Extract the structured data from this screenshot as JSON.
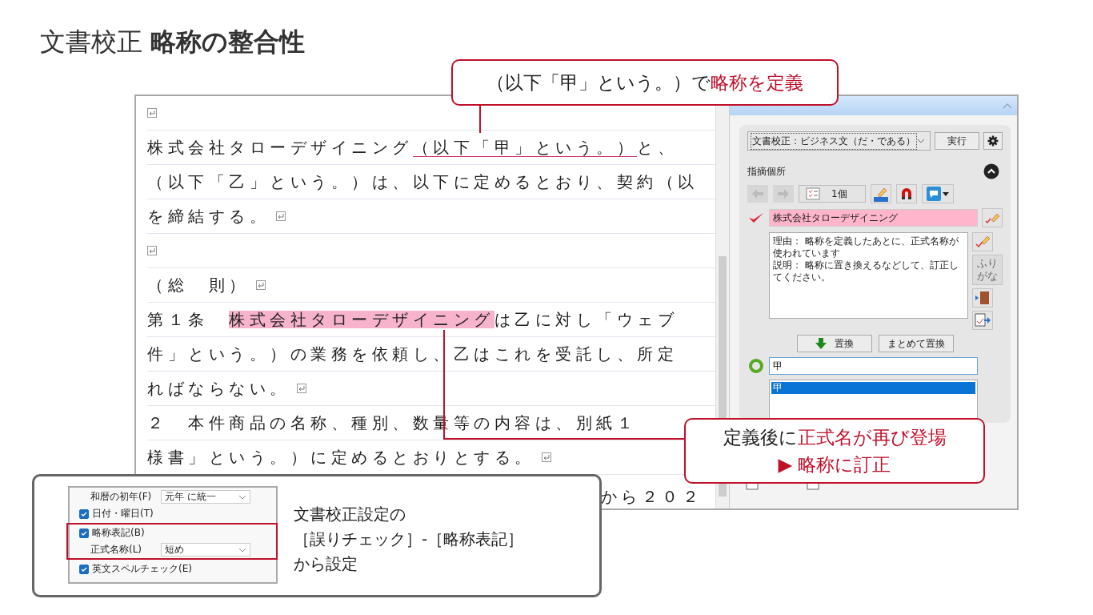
{
  "title": "文書校正 **略称の整合性**",
  "document": {
    "lines": [
      {
        "return_mark": true
      },
      {
        "segments": [
          {
            "text": "株式会社タローデザイニング",
            "kind": "plain"
          },
          {
            "text": "（以下「甲」という。）",
            "kind": "underlined"
          },
          {
            "text": "と、",
            "kind": "plain"
          }
        ],
        "return_mark": false
      },
      {
        "segments": [
          {
            "text": "（以下「乙」という。）は、以下に定めるとおり、契約（以",
            "kind": "plain"
          }
        ],
        "return_mark": false
      },
      {
        "segments": [
          {
            "text": "を締結する。",
            "kind": "plain"
          }
        ],
        "return_mark": true
      },
      {
        "return_mark": true
      },
      {
        "segments": [
          {
            "text": "（総　則）",
            "kind": "plain"
          }
        ],
        "return_mark": true
      },
      {
        "segments": [
          {
            "text": "第１条　",
            "kind": "plain"
          },
          {
            "text": "株式会社タローデザイニング",
            "kind": "highlighted"
          },
          {
            "text": "は乙に対し「ウェブ",
            "kind": "plain"
          }
        ],
        "return_mark": false
      },
      {
        "segments": [
          {
            "text": "件」という。）の業務を依頼し、乙はこれを受託し、所定",
            "kind": "plain"
          }
        ],
        "return_mark": false
      },
      {
        "segments": [
          {
            "text": "ればならない。",
            "kind": "plain"
          }
        ],
        "return_mark": true
      },
      {
        "segments": [
          {
            "text": "２　本件商品の名称、種別、数量等の内容は、別紙１",
            "kind": "plain"
          }
        ],
        "return_mark": false
      },
      {
        "segments": [
          {
            "text": "様書」という。）に定めるとおりとする。",
            "kind": "plain"
          }
        ],
        "return_mark": true
      }
    ],
    "partial_line": "から２０２"
  },
  "panel": {
    "profile_select": {
      "value": "文書校正：ビジネス文（だ・である）"
    },
    "run_button": "実行",
    "section_label": "指摘個所",
    "nav": [
      {
        "kind": "back",
        "disabled": true
      },
      {
        "kind": "forward",
        "disabled": true
      }
    ],
    "count": "1個",
    "flagged_text": "株式会社タローデザイニング",
    "message": [
      "理由： 略称を定義したあとに、正式名称が使われています",
      "説明： 略称に置き換えるなどして、訂正してください。"
    ],
    "furigana_button": {
      "label": "ふりがな",
      "disabled": true
    },
    "replace_button": "置換",
    "replace_all_button": "まとめて置換",
    "candidate_input": {
      "value": "甲"
    },
    "candidates": [
      {
        "label": "甲",
        "selected": true
      }
    ]
  },
  "callouts": [
    {
      "kind": "top",
      "lines": [
        [
          {
            "text": "（以下「甲」という。）で",
            "emphasis": false
          },
          {
            "text": "略称を定義",
            "emphasis": true
          }
        ]
      ]
    },
    {
      "kind": "bottom",
      "lines": [
        [
          {
            "text": "定義後に",
            "emphasis": false
          },
          {
            "text": "正式名が再び登場",
            "emphasis": true
          }
        ],
        [
          {
            "text": "▶ 略称に訂正",
            "emphasis": true
          }
        ]
      ]
    }
  ],
  "settings": {
    "rows": [
      {
        "kind": "select",
        "label": "和暦の初年(F)",
        "value": "元年 に統一",
        "highlighted": false
      },
      {
        "kind": "checkbox",
        "label": "日付・曜日(T)",
        "checked": true,
        "highlighted": false
      },
      {
        "kind": "checkbox",
        "label": "略称表記(B)",
        "checked": true,
        "highlighted": true
      },
      {
        "kind": "select",
        "label": "正式名称(L)",
        "value": "短め",
        "highlighted": true
      },
      {
        "kind": "checkbox",
        "label": "英文スペルチェック(E)",
        "checked": true,
        "highlighted": false
      }
    ],
    "caption": [
      "文書校正設定の",
      "［誤りチェック］-［略称表記］",
      "から設定"
    ]
  }
}
